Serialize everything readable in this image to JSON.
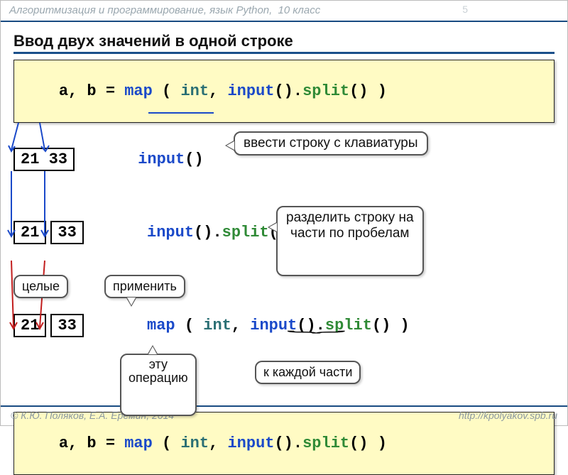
{
  "header": {
    "course": "Алгоритмизация и программирование, язык",
    "lang": "Python",
    "grade": "10 класс",
    "page_num": "5"
  },
  "title": "Ввод двух значений в одной строке",
  "main_code": {
    "assign": "a, b = ",
    "map": "map",
    "open": " ( ",
    "int": "int",
    "comma": ", ",
    "input": "input",
    "call1": "().",
    "split": "split",
    "end": "() )"
  },
  "step1": {
    "raw": "21 33",
    "input_kw": "input",
    "call": "()",
    "callout": "ввести строку с клавиатуры"
  },
  "step2": {
    "v1": "21",
    "v2": "33",
    "input_kw": "input",
    "call1": "().",
    "split": "split",
    "call2": "()",
    "callout": "разделить строку на\nчасти по пробелам"
  },
  "step3": {
    "v1": "21",
    "v2": "33",
    "map": "map",
    "open": " ( ",
    "int": "int",
    "comma": ", ",
    "input": "input",
    "call1": "().",
    "split": "split",
    "end": "() )",
    "note_int": "целые",
    "note_map": "применить",
    "note_op": "эту\nоперацию",
    "note_each": "к каждой части"
  },
  "footer": {
    "left": "© К.Ю. Поляков, Е.А. Ерёмин, 2014",
    "right": "http://kpolyakov.spb.ru"
  }
}
